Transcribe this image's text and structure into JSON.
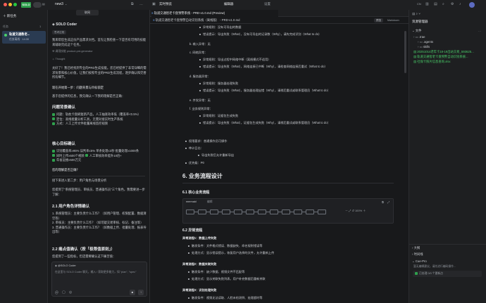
{
  "app": {
    "badge": "SOLO",
    "cn_label": "CN",
    "new_task": "新任务",
    "tasks_header": "任务",
    "tasks_count": "1",
    "task_title": "轨道交通教老...",
    "task_sub": "任务离线 · 14:30"
  },
  "chat": {
    "tab_title": "new3",
    "top_chip": "联网",
    "agent_name": "SOLO Coder",
    "agent_tag": "思考过程",
    "intro": "我来帮您生成这份产品需求文档。首先让我检查一下是否有可用的技能来辅助完成这个任务。",
    "skill_used": "调用技能 product-prd-generator",
    "thought": "Thought",
    "p1": "太好了！我已经找到专业的PRD生成技能。您已经提供了非常详细的需求背景和核心价值，让我们按照专业的PRD生成流程，逐步确认和完善所有细节。",
    "p2": "现在开始第一步：问题背景与目标锁定",
    "p3": "基于您提供的信息，我先确认一下我的理解是否正确：",
    "h1": "问题背景确认",
    "checks1": [
      "问题：轨枕卡盘刷复新产品，人工抽查效率低（覆盖率<0.5%）",
      "定位：高线批量分析工具，无需对接实时生产系统",
      "方式：人工上传文件批量离线监控视频"
    ],
    "h2": "核心目标确认",
    "checks2": [
      "识别覆盖率≥95% 误判率≤5% 单条处理≤3秒 批量处理≥1000条",
      "同时上传≥500个视频",
      "人工审核效率提升10倍+",
      "年省运维≥500万元"
    ],
    "q1": "您的理解是否正确？",
    "step2": "接下来进入第二步：用户角色与场景分析",
    "step2b": "您提到了\"系统管理员、审核员、普通操作员\"三个角色。我需要进一步了解：",
    "h3": "2.1 用户角色详情确认",
    "roles": [
      "1. 系统管理员：主要负责什么工作？（如用户管理、权限配置、数据清空等）",
      "2. 审核员：主要负责什么工作？（如可疑交易审核、标记、备注等）",
      "3. 普通操作员：主要负责什么工作？（如数据上传、批量处理、报表导出等）"
    ],
    "h4": "2.2 痛点值确认（按「极限值原则」）",
    "p4": "您提到了一些指标，但还需要确认这下痛苦值：",
    "input_agent": "@SOLO Coder",
    "input_placeholder": "在这里与 SOLO Coder 聊天，输入 / 获取更多能力，如 \"plan\", \"spec\""
  },
  "editor": {
    "tab1": "实时预览",
    "tab2": "编辑器",
    "tab3": "设置",
    "file_tab": "轨道交通智老卡盘预警系统 - PRD-v1.0.md (Preview)",
    "breadcrumb": "轨道交通智老卡盘预警自动识别系统（离线版） - PRD-v1.0.md",
    "view_preview": "预览",
    "view_markdown": "Markdown",
    "lines_top": [
      {
        "indent": 1,
        "text": "异常规则：没有可导出的数据"
      },
      {
        "indent": 1,
        "text": "错误提示：导出失败（What），没有可导出的记录数（Why），请先完成识别（What to do）"
      },
      {
        "indent": 0,
        "text": "b. 输入异常：无"
      },
      {
        "indent": 0,
        "text": "c. 网络异常："
      },
      {
        "indent": 1,
        "text": "异常规则：导出过程中网络中断（离线模式不适用）"
      },
      {
        "indent": 1,
        "text": "错误提示：导出失败（What），网络连接已中断（Why），请检查网络连接后重试（What to do）"
      },
      {
        "indent": 0,
        "text": "d. 服务器异常："
      },
      {
        "indent": 1,
        "text": "异常规则：服务器处理失败"
      },
      {
        "indent": 1,
        "text": "错误提示：导出失败（What），服务器处理出错（Why），请稍后重试或联系管理员（What to do）"
      },
      {
        "indent": 0,
        "text": "e. 并发异常：无"
      },
      {
        "indent": 0,
        "text": "f. 业务规则异常："
      },
      {
        "indent": 1,
        "text": "异常规则：证据包生成失败"
      },
      {
        "indent": 1,
        "text": "错误提示：导出失败（What），证据包生成失败（Why），请稍后重试或联系管理员（What to do）"
      }
    ],
    "perm": "权限要求：普通操作员可操作",
    "audit": "审计日志：",
    "audit_sub": "导出失败后允许重新导出",
    "priority": "优先级：P0",
    "h_section": "6. 业务流程设计",
    "h_sub": "6.1 核心业务流程",
    "mermaid_label": "mermaid",
    "mermaid_edit": "编辑",
    "zoom": "100%",
    "h_sub2": "6.2 异常流程",
    "flows": [
      {
        "title": "异常流程1：数据上传失败",
        "items": [
          "触发条件：文件格式错误、数据缺失、命名规则错误等",
          "处理方式：显示错误提示，恢复用户选择的文件，允许重新上传"
        ]
      },
      {
        "title": "异常流程2：数据关联失败",
        "items": [
          "触发条件：缺少数据、视频文件不匹配等",
          "处理方式：显示关联失败列表，用户补充数据后重新关联"
        ]
      },
      {
        "title": "异常流程3：识别处理失败",
        "items": [
          "触发条件：视频无法读取、人脸未检测到、处理超时等"
        ]
      }
    ]
  },
  "explorer": {
    "title": "资源管理器",
    "section": "文件",
    "items": [
      {
        "level": 0,
        "type": "folder",
        "label": ".trae"
      },
      {
        "level": 1,
        "type": "folder",
        "label": ".agents"
      },
      {
        "level": 1,
        "type": "folder",
        "label": "skills"
      },
      {
        "level": 0,
        "type": "file",
        "label": "20251014老年卡18-19出站交易_593625...",
        "color": "green"
      },
      {
        "level": 0,
        "type": "file",
        "label": "轨道交通智老卡盘预警自动识别系统...",
        "color": "green"
      },
      {
        "level": 0,
        "type": "file",
        "label": "社保卡照片信息查询.xlsx",
        "color": "green"
      }
    ],
    "outline": "大纲",
    "timeline": "时间线",
    "cue": "Cue-Pro",
    "cue_msg": "暂无编辑建议，请先进行编码操作...",
    "cue_status": "已处理 0/0 个更新点"
  },
  "colors": {
    "accent": "#2fa14d",
    "bg": "#1b1c1e",
    "panel": "#1e1f21"
  }
}
